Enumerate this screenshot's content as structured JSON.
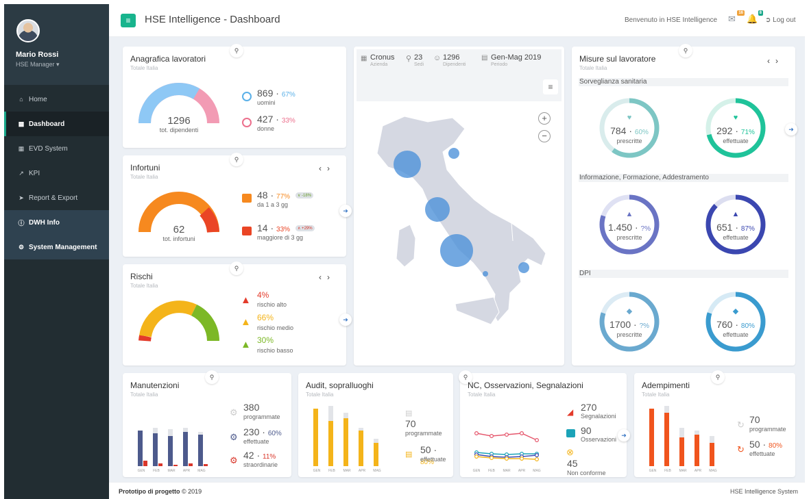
{
  "user": {
    "name": "Mario Rossi",
    "role": "HSE Manager ▾"
  },
  "menu": [
    "Home",
    "Dashboard",
    "EVD System",
    "KPI",
    "Report & Export",
    "DWH Info",
    "System Management"
  ],
  "header": {
    "title": "HSE Intelligence - Dashboard",
    "welcome": "Benvenuto in HSE Intelligence",
    "mail_badge": "16",
    "bell_badge": "8",
    "logout": "Log out"
  },
  "subtitle": "Totale Italia",
  "anagrafica": {
    "title": "Anagrafica lavoratori",
    "total": "1296",
    "total_label": "tot. dipendenti",
    "men": "869",
    "men_pct": "67%",
    "men_label": "uomini",
    "women": "427",
    "women_pct": "33%",
    "women_label": "donne",
    "men_fraction": 0.67
  },
  "infortuni": {
    "title": "Infortuni",
    "total": "62",
    "total_label": "tot. infortuni",
    "a_val": "48",
    "a_pct": "77%",
    "a_label": "da 1 a 3 gg",
    "a_chip": "∨ -18%",
    "b_val": "14",
    "b_pct": "33%",
    "b_label": "maggiore di 3 gg",
    "b_chip": "∧ +29%"
  },
  "rischi": {
    "title": "Rischi",
    "alto": "4%",
    "alto_label": "rischio alto",
    "medio": "66%",
    "medio_label": "rischio medio",
    "basso": "30%",
    "basso_label": "rischio basso"
  },
  "map": {
    "azienda": "Cronus",
    "azienda_label": "Azienda",
    "sedi": "23",
    "sedi_label": "Sedi",
    "dip": "1296",
    "dip_label": "Dipendenti",
    "periodo": "Gen-Mag 2019",
    "periodo_label": "Periodo"
  },
  "misure": {
    "title": "Misure sul lavoratore",
    "sec1": "Sorveglianza sanitaria",
    "sec2": "Informazione, Formazione, Addestramento",
    "sec3": "DPI",
    "r1a": {
      "v": "784",
      "p": "60%",
      "l": "prescritte",
      "f": 0.6
    },
    "r1b": {
      "v": "292",
      "p": "71%",
      "l": "effettuate",
      "f": 0.71
    },
    "r2a": {
      "v": "1.450",
      "p": "?%",
      "l": "prescritte",
      "f": 0.8
    },
    "r2b": {
      "v": "651",
      "p": "87%",
      "l": "effettuate",
      "f": 0.87
    },
    "r3a": {
      "v": "1700",
      "p": "?%",
      "l": "prescritte",
      "f": 0.8
    },
    "r3b": {
      "v": "760",
      "p": "80%",
      "l": "effettuate",
      "f": 0.8
    }
  },
  "months": [
    "GEN",
    "FEB",
    "MAR",
    "APR",
    "MAG"
  ],
  "manut": {
    "title": "Manutenzioni",
    "v1": "380",
    "l1": "programmate",
    "v2": "230",
    "p2": "60%",
    "l2": "effettuate",
    "v3": "42",
    "p3": "11%",
    "l3": "straordinarie"
  },
  "audit": {
    "title": "Audit, sopralluoghi",
    "v1": "70",
    "l1": "programmate",
    "v2": "50",
    "p2": "80%",
    "l2": "effettuate"
  },
  "nc": {
    "title": "NC, Osservazioni, Segnalazioni",
    "v1": "270",
    "l1": "Segnalazioni",
    "v2": "90",
    "l2": "Osservazioni",
    "v3": "45",
    "l3": "Non conforme"
  },
  "adempi": {
    "title": "Adempimenti",
    "v1": "70",
    "l1": "programmate",
    "v2": "50",
    "p2": "80%",
    "l2": "effettuate"
  },
  "footer": {
    "left": "Prototipo di progetto",
    "copy": "© 2019",
    "right": "HSE Intelligence System"
  }
}
